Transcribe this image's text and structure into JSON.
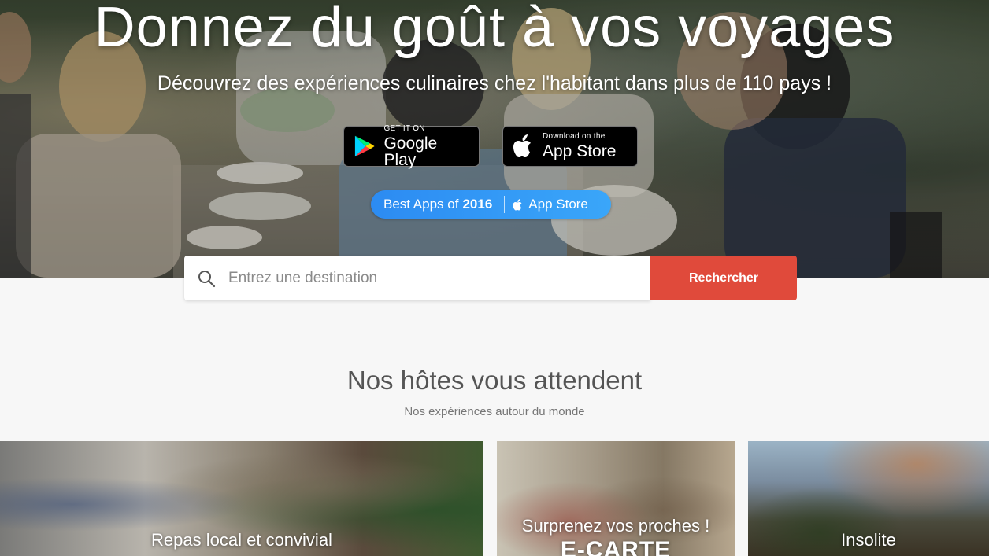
{
  "hero": {
    "title": "Donnez du goût à vos voyages",
    "subtitle": "Découvrez des expériences culinaires chez l'habitant dans plus de 110 pays !"
  },
  "apps": {
    "google_play": {
      "small": "GET IT ON",
      "big": "Google Play",
      "icon": "google-play-icon"
    },
    "app_store": {
      "small": "Download on the",
      "big": "App Store",
      "icon": "apple-icon"
    },
    "badge": {
      "prefix": "Best Apps of",
      "year": "2016",
      "store": "App Store"
    }
  },
  "search": {
    "placeholder": "Entrez une destination",
    "button_label": "Rechercher",
    "accent_color": "#e04a3b"
  },
  "section": {
    "title": "Nos hôtes vous attendent",
    "subtitle": "Nos expériences autour du monde"
  },
  "cards": [
    {
      "label": "Repas local et convivial"
    },
    {
      "label": "Surprenez vos proches !",
      "sublabel": "E-CARTE"
    },
    {
      "label": "Insolite"
    }
  ]
}
